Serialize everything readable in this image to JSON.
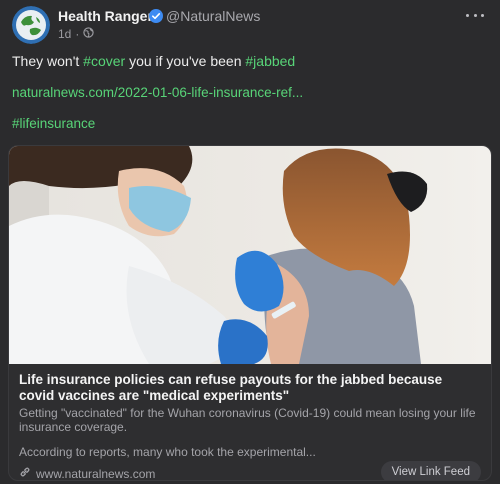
{
  "post": {
    "author_name": "Health Ranger",
    "handle": "@NaturalNews",
    "time": "1d",
    "separator": "·",
    "text_before": "They won't ",
    "hashtag_1": "#cover",
    "text_middle": " you if you've been ",
    "hashtag_2": "#jabbed",
    "link": "naturalnews.com/2022-01-06-life-insurance-ref...",
    "hashtag_3": "#lifeinsurance"
  },
  "link_card": {
    "title": "Life insurance policies can refuse payouts for the jabbed because covid vaccines are \"medical experiments\"",
    "description": "Getting \"vaccinated\" for the Wuhan coronavirus (Covid-19) could mean losing your life insurance coverage.",
    "description_2": "According to reports, many who took the experimental...",
    "domain": "www.naturalnews.com",
    "view_button": "View Link Feed"
  },
  "colors": {
    "background": "#2b2b2d",
    "accent_green": "#58d478",
    "verified_blue": "#3d8bf2"
  },
  "icons": {
    "verified": "verified-check-icon",
    "globe": "globe-icon",
    "more": "more-dots-icon",
    "link": "link-icon"
  }
}
